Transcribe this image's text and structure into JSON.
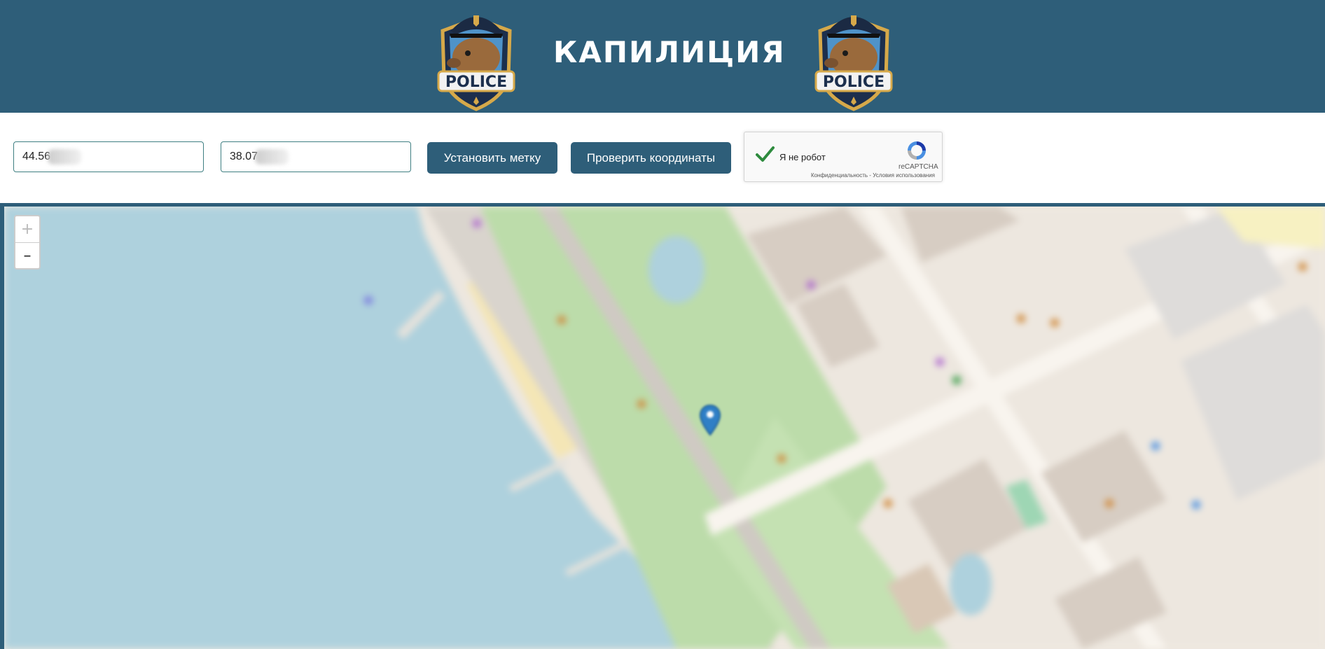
{
  "header": {
    "title": "КАПИЛИЦИЯ",
    "badge_text": "POLICE",
    "brand_color": "#2e5e79"
  },
  "form": {
    "latitude_value": "44.56",
    "longitude_value": "38.07",
    "set_marker_label": "Установить метку",
    "check_coords_label": "Проверить координаты"
  },
  "captcha": {
    "label": "Я не робот",
    "brand": "reCAPTCHA",
    "terms": "Конфиденциальность - Условия использования",
    "checked": true
  },
  "map": {
    "zoom_in_label": "+",
    "zoom_out_label": "–",
    "icons": {
      "zoom_in": "plus-icon",
      "zoom_out": "minus-icon",
      "marker": "map-pin-icon",
      "captcha_check": "checkmark-icon",
      "captcha_logo": "recaptcha-logo-icon",
      "badge": "capybara-police-badge"
    }
  }
}
